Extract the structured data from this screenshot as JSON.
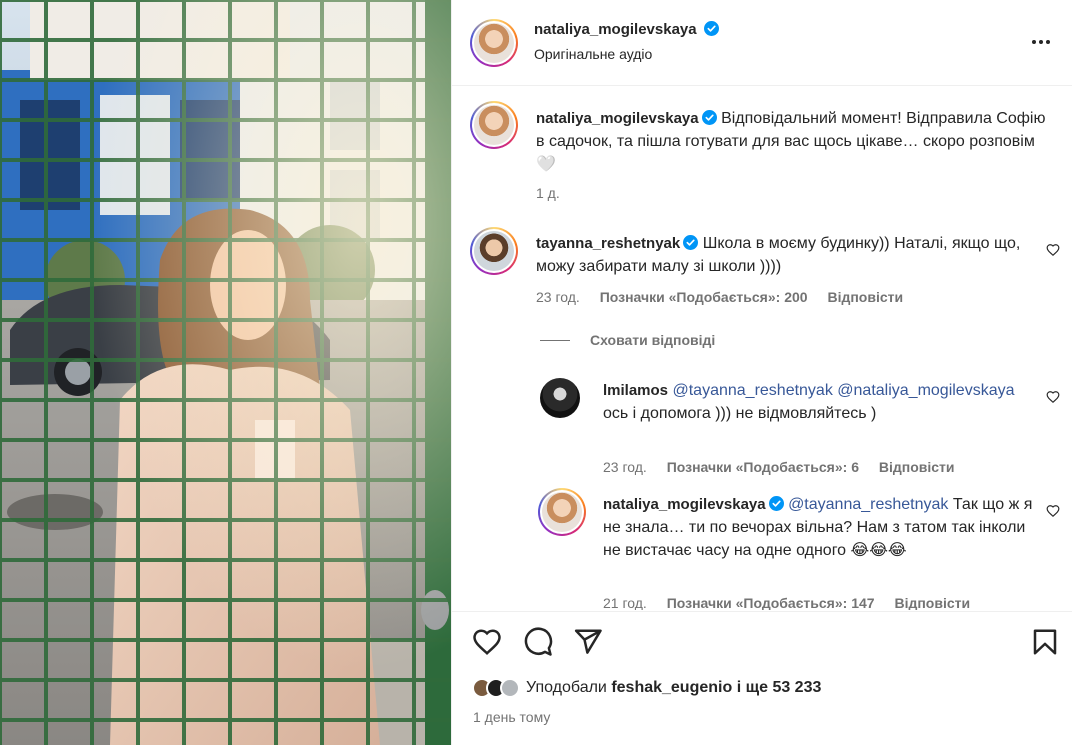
{
  "post": {
    "author": "nataliya_mogilevskaya",
    "audio": "Оригінальне аудіо",
    "caption": "Відповідальний момент! Відправила Софію в садочок, та пішла готувати для вас щось цікаве… скоро розповім",
    "caption_emoji": "🤍",
    "caption_time": "1 д."
  },
  "comments": [
    {
      "user": "tayanna_reshetnyak",
      "verified": true,
      "text": "Школа в моєму будинку)) Наталі, якщо що, можу забирати малу зі школи ))))",
      "time": "23 год.",
      "likes": "Позначки «Подобається»: 200",
      "reply": "Відповісти",
      "hide_replies": "Сховати відповіді",
      "replies": [
        {
          "user": "lmilamos",
          "verified": false,
          "mention1": "@tayanna_reshetnyak",
          "mention2": "@nataliya_mogilevskaya",
          "text": "ось і допомога ))) не відмовляйтесь )",
          "time": "23 год.",
          "likes": "Позначки «Подобається»: 6",
          "reply": "Відповісти"
        },
        {
          "user": "nataliya_mogilevskaya",
          "verified": true,
          "mention1": "@tayanna_reshetnyak",
          "text": "Так що ж я не знала… ти по вечорах вільна? Нам з татом так інколи не вистачає часу на одне одного",
          "emoji": "😂😂😂",
          "time": "21 год.",
          "likes": "Позначки «Подобається»: 147",
          "reply": "Відповісти"
        }
      ]
    }
  ],
  "likes": {
    "prefix": "Уподобали",
    "user": "feshak_eugenio",
    "suffix": "і ще 53 233"
  },
  "date": "1 день тому",
  "icons": {
    "verified": "verified-badge-icon",
    "more": "more-options-icon",
    "like": "heart-icon",
    "comment": "comment-icon",
    "share": "share-icon",
    "save": "bookmark-icon"
  },
  "colors": {
    "verified": "#0095f6",
    "secondary": "#737373",
    "mention": "#385898"
  }
}
